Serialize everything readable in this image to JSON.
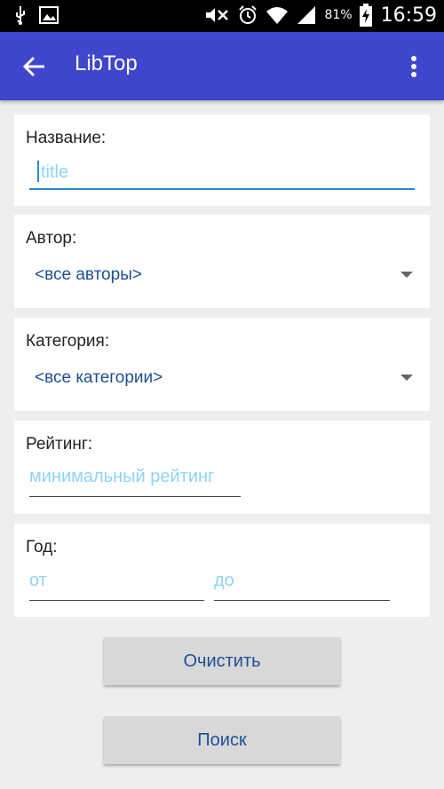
{
  "status_bar": {
    "icons": [
      "usb-icon",
      "image-icon",
      "mute-icon",
      "alarm-icon",
      "wifi-icon",
      "signal-icon",
      "battery-charging-icon"
    ],
    "battery": "81%",
    "time": "16:59"
  },
  "app_bar": {
    "title": "LibTop",
    "color": "#3f45cc"
  },
  "form": {
    "title_label": "Название:",
    "title_placeholder": "title",
    "author_label": "Автор:",
    "author_value": "<все авторы>",
    "category_label": "Категория:",
    "category_value": "<все категории>",
    "rating_label": "Рейтинг:",
    "rating_placeholder": "минимальный рейтинг",
    "year_label": "Год:",
    "year_from_placeholder": "от",
    "year_to_placeholder": "до"
  },
  "buttons": {
    "clear": "Очистить",
    "search": "Поиск"
  }
}
